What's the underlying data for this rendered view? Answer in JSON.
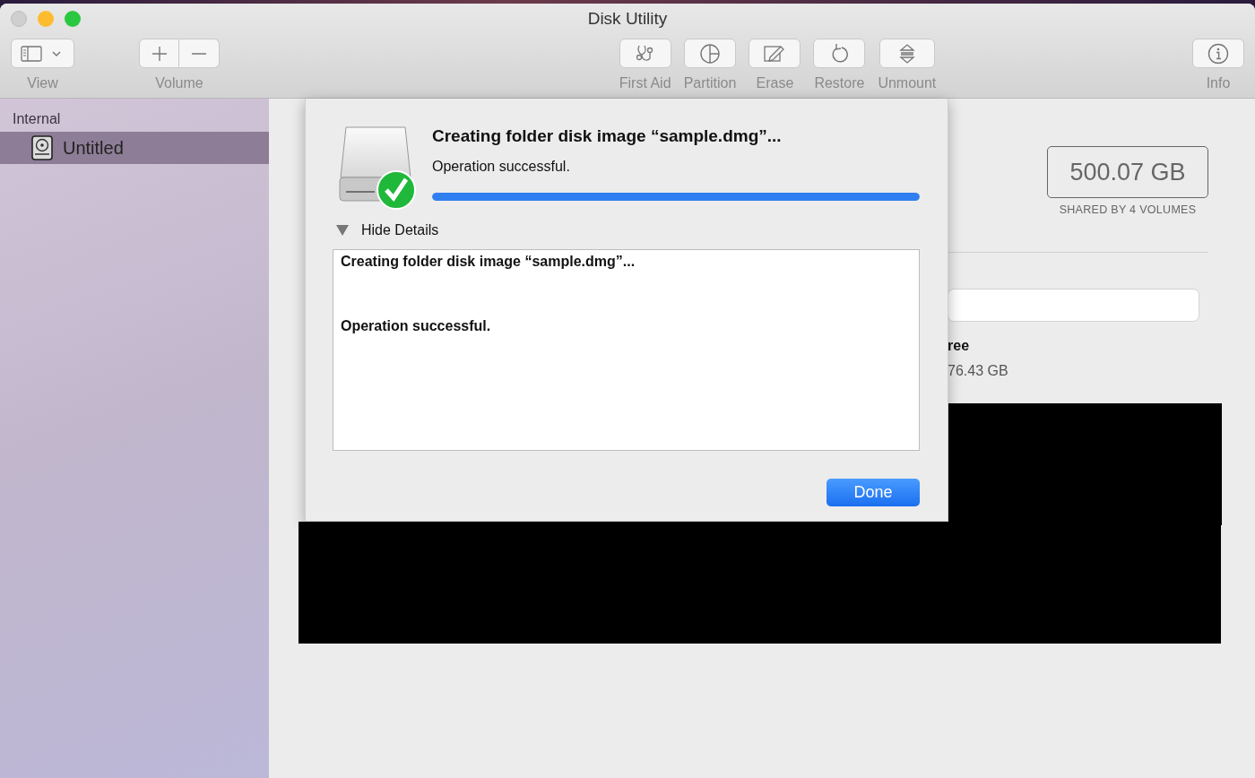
{
  "window": {
    "title": "Disk Utility"
  },
  "toolbar": [
    {
      "kind": "view",
      "label": "View"
    },
    {
      "kind": "volume",
      "label": "Volume"
    },
    {
      "kind": "first_aid",
      "label": "First Aid"
    },
    {
      "kind": "partition",
      "label": "Partition"
    },
    {
      "kind": "erase",
      "label": "Erase"
    },
    {
      "kind": "restore",
      "label": "Restore"
    },
    {
      "kind": "unmount",
      "label": "Unmount"
    },
    {
      "kind": "info",
      "label": "Info"
    }
  ],
  "sidebar": {
    "section": "Internal",
    "items": [
      {
        "label": "Untitled",
        "selected": true
      }
    ]
  },
  "main": {
    "capacity": "500.07 GB",
    "capacity_note": "SHARED BY 4 VOLUMES",
    "free_label": "ree",
    "free_value": "76.43 GB"
  },
  "dialog": {
    "title": "Creating folder disk image “sample.dmg”...",
    "status": "Operation successful.",
    "progress": {
      "level": 1
    },
    "details_toggle": {
      "label": "Hide Details",
      "expanded": true
    },
    "details_lines": [
      "Creating folder disk image “sample.dmg”...",
      "Operation successful."
    ],
    "button": "Done"
  }
}
